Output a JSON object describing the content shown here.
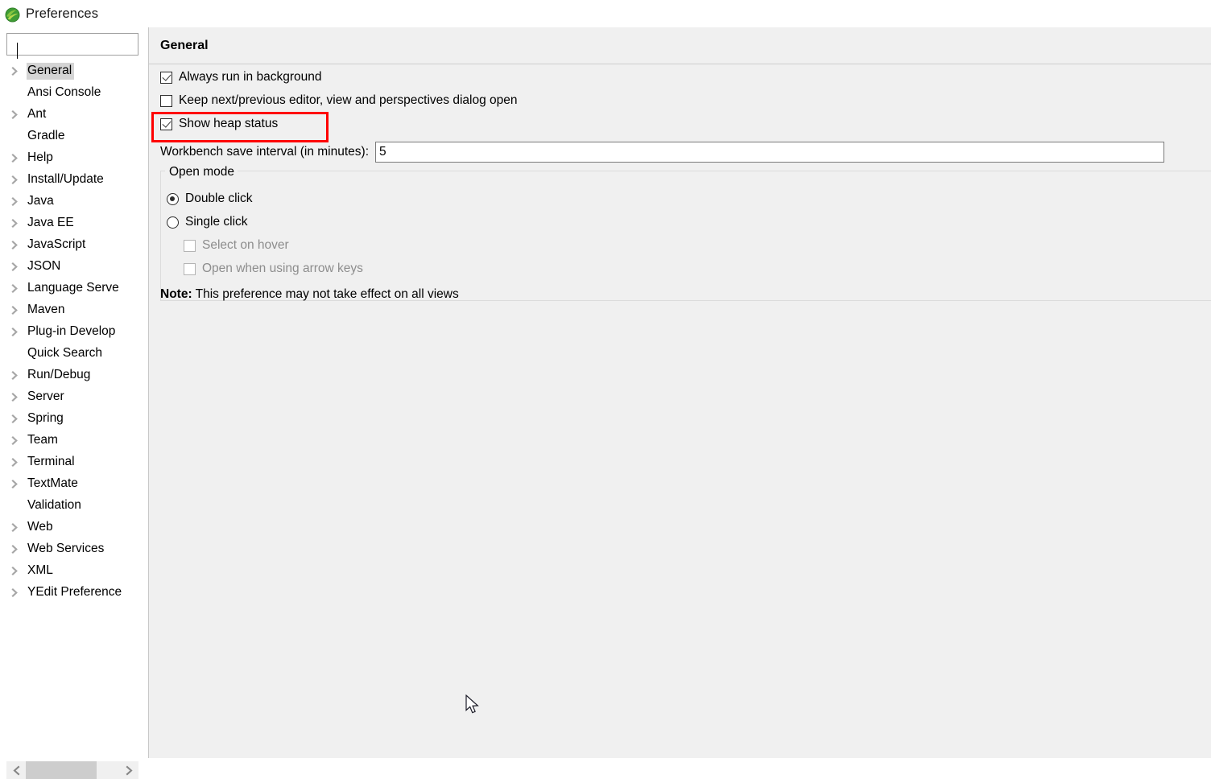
{
  "window": {
    "title": "Preferences",
    "icon": "eclipse-globe-icon"
  },
  "sidebar": {
    "filter": {
      "value": "",
      "placeholder": ""
    },
    "items": [
      {
        "label": "General",
        "expandable": true,
        "selected": true
      },
      {
        "label": "Ansi Console",
        "expandable": false,
        "selected": false
      },
      {
        "label": "Ant",
        "expandable": true,
        "selected": false
      },
      {
        "label": "Gradle",
        "expandable": false,
        "selected": false
      },
      {
        "label": "Help",
        "expandable": true,
        "selected": false
      },
      {
        "label": "Install/Update",
        "expandable": true,
        "selected": false
      },
      {
        "label": "Java",
        "expandable": true,
        "selected": false
      },
      {
        "label": "Java EE",
        "expandable": true,
        "selected": false
      },
      {
        "label": "JavaScript",
        "expandable": true,
        "selected": false
      },
      {
        "label": "JSON",
        "expandable": true,
        "selected": false
      },
      {
        "label": "Language Serve",
        "expandable": true,
        "selected": false
      },
      {
        "label": "Maven",
        "expandable": true,
        "selected": false
      },
      {
        "label": "Plug-in Develop",
        "expandable": true,
        "selected": false
      },
      {
        "label": "Quick Search",
        "expandable": false,
        "selected": false
      },
      {
        "label": "Run/Debug",
        "expandable": true,
        "selected": false
      },
      {
        "label": "Server",
        "expandable": true,
        "selected": false
      },
      {
        "label": "Spring",
        "expandable": true,
        "selected": false
      },
      {
        "label": "Team",
        "expandable": true,
        "selected": false
      },
      {
        "label": "Terminal",
        "expandable": true,
        "selected": false
      },
      {
        "label": "TextMate",
        "expandable": true,
        "selected": false
      },
      {
        "label": "Validation",
        "expandable": false,
        "selected": false
      },
      {
        "label": "Web",
        "expandable": true,
        "selected": false
      },
      {
        "label": "Web Services",
        "expandable": true,
        "selected": false
      },
      {
        "label": "XML",
        "expandable": true,
        "selected": false
      },
      {
        "label": "YEdit Preference",
        "expandable": true,
        "selected": false
      }
    ],
    "scrollbar": {
      "left_arrow": "‹",
      "right_arrow": "›"
    }
  },
  "main": {
    "title": "General",
    "checkboxes": [
      {
        "label": "Always run in background",
        "checked": true,
        "enabled": true
      },
      {
        "label": "Keep next/previous editor, view and perspectives dialog open",
        "checked": false,
        "enabled": true
      },
      {
        "label": "Show heap status",
        "checked": true,
        "enabled": true
      }
    ],
    "save_interval": {
      "label": "Workbench save interval (in minutes):",
      "value": "5"
    },
    "open_mode": {
      "legend": "Open mode",
      "radios": [
        {
          "label": "Double click",
          "selected": true
        },
        {
          "label": "Single click",
          "selected": false
        }
      ],
      "sub_checkboxes": [
        {
          "label": "Select on hover",
          "checked": false,
          "enabled": false
        },
        {
          "label": "Open when using arrow keys",
          "checked": false,
          "enabled": false
        }
      ],
      "note_label": "Note:",
      "note_text": " This preference may not take effect on all views"
    }
  },
  "annotation": {
    "highlight_color": "#fe0000",
    "target": "Show heap status"
  }
}
